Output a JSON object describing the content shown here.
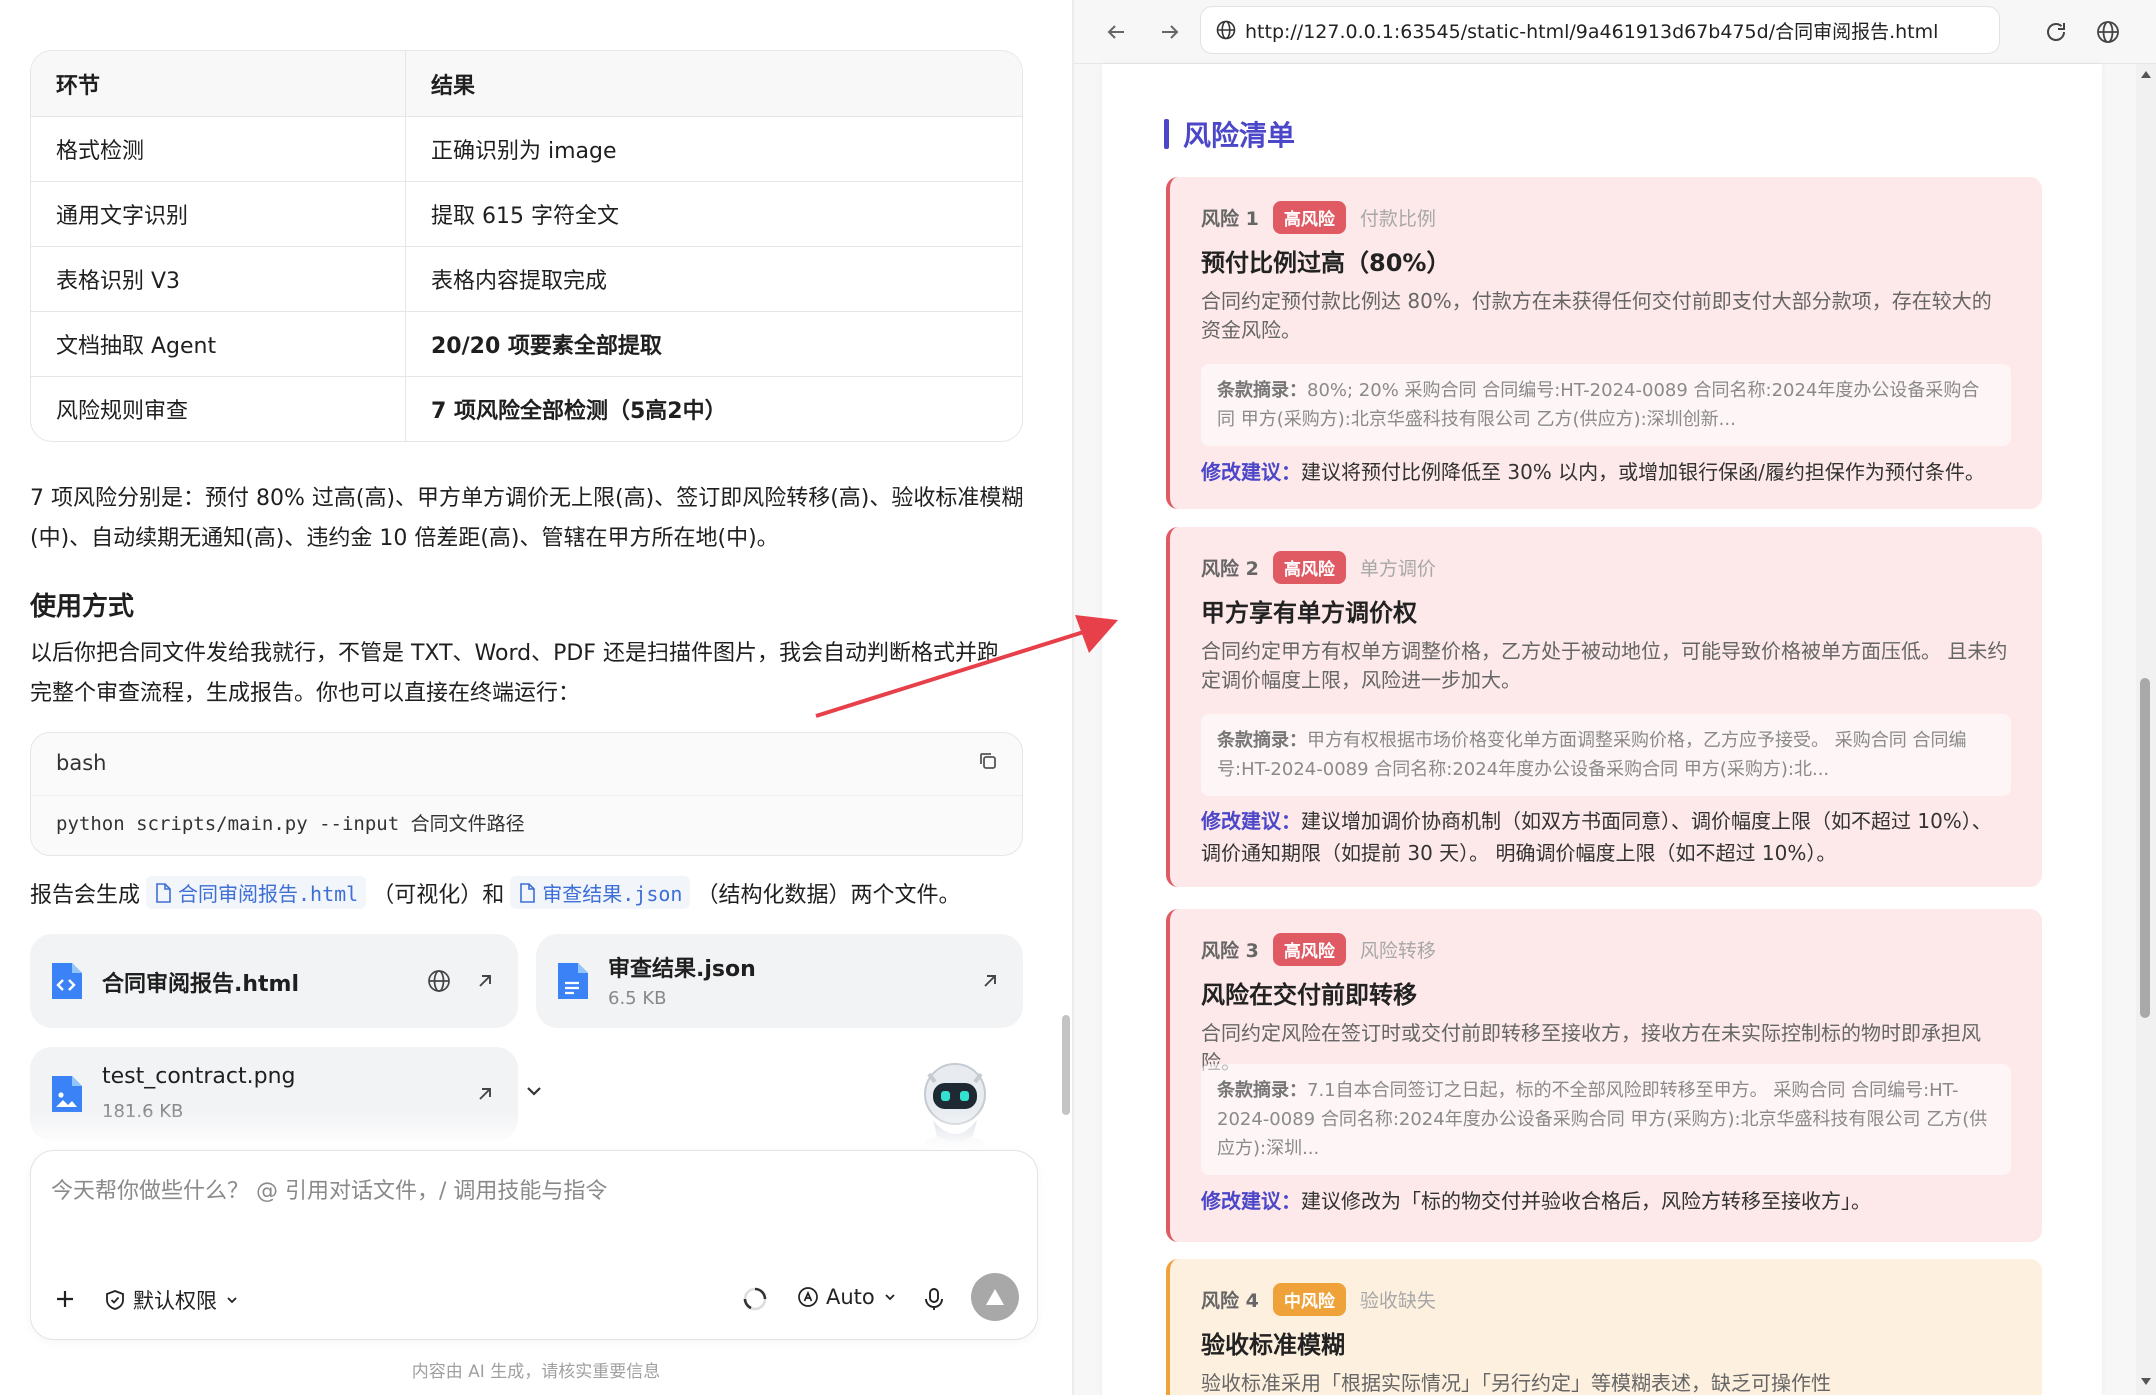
{
  "chat": {
    "table": {
      "headers": [
        "环节",
        "结果"
      ],
      "rows": [
        {
          "step": "格式检测",
          "result": "正确识别为 image",
          "bold": false
        },
        {
          "step": "通用文字识别",
          "result": "提取 615 字符全文",
          "bold": false
        },
        {
          "step": "表格识别 V3",
          "result": "表格内容提取完成",
          "bold": false
        },
        {
          "step": "文档抽取 Agent",
          "result": "20/20 项要素全部提取",
          "bold": true
        },
        {
          "step": "风险规则审查",
          "result": "7 项风险全部检测（5高2中）",
          "bold": true
        }
      ]
    },
    "summary_line1": "7 项风险分别是：预付 80% 过高(高)、甲方单方调价无上限(高)、签订即风险转移(高)、验收标准模糊",
    "summary_line2": "(中)、自动续期无通知(高)、违约金 10 倍差距(高)、管辖在甲方所在地(中)。",
    "usage_heading": "使用方式",
    "usage_line1": "以后你把合同文件发给我就行，不管是 TXT、Word、PDF 还是扫描件图片，我会自动判断格式并跑",
    "usage_line2": "完整个审查流程，生成报告。你也可以直接在终端运行：",
    "code": {
      "lang": "bash",
      "command": "python scripts/main.py --input 合同文件路径"
    },
    "report_text_before": "报告会生成",
    "report_file1": "合同审阅报告.html",
    "report_text_mid": "（可视化）和",
    "report_file2": "审查结果.json",
    "report_text_after": "（结构化数据）两个文件。",
    "files": [
      {
        "name": "合同审阅报告.html",
        "size": "",
        "icon": "code-file-icon"
      },
      {
        "name": "审查结果.json",
        "size": "6.5 KB",
        "icon": "doc-file-icon"
      },
      {
        "name": "test_contract.png",
        "size": "181.6 KB",
        "icon": "image-file-icon"
      }
    ],
    "input_placeholder": "今天帮你做些什么？ @ 引用对话文件，/ 调用技能与指令",
    "permission_label": "默认权限",
    "model_label": "Auto",
    "footnote": "内容由 AI 生成，请核实重要信息"
  },
  "browser": {
    "url": "http://127.0.0.1:63545/static-html/9a461913d67b475d/合同审阅报告.html",
    "section_title": "风险清单",
    "risks": [
      {
        "num": "风险 1",
        "level": "高风险",
        "category": "付款比例",
        "title": "预付比例过高（80%）",
        "desc": "合同约定预付款比例达 80%，付款方在未获得任何交付前即支付大部分款项，存在较大的资金风险。",
        "clause_label": "条款摘录：",
        "clause": "80%; 20% 采购合同 合同编号:HT-2024-0089 合同名称:2024年度办公设备采购合同 甲方(采购方):北京华盛科技有限公司 乙方(供应方):深圳创新...",
        "sugg_label": "修改建议：",
        "sugg": "建议将预付比例降低至 30% 以内，或增加银行保函/履约担保作为预付条件。"
      },
      {
        "num": "风险 2",
        "level": "高风险",
        "category": "单方调价",
        "title": "甲方享有单方调价权",
        "desc": "合同约定甲方有权单方调整价格，乙方处于被动地位，可能导致价格被单方面压低。 且未约定调价幅度上限，风险进一步加大。",
        "clause_label": "条款摘录：",
        "clause": "甲方有权根据市场价格变化单方面调整采购价格，乙方应予接受。 采购合同 合同编号:HT-2024-0089 合同名称:2024年度办公设备采购合同 甲方(采购方):北...",
        "sugg_label": "修改建议：",
        "sugg": "建议增加调价协商机制（如双方书面同意）、调价幅度上限（如不超过 10%）、调价通知期限（如提前 30 天）。 明确调价幅度上限（如不超过 10%）。"
      },
      {
        "num": "风险 3",
        "level": "高风险",
        "category": "风险转移",
        "title": "风险在交付前即转移",
        "desc": "合同约定风险在签订时或交付前即转移至接收方，接收方在未实际控制标的物时即承担风险。",
        "clause_label": "条款摘录：",
        "clause": "7.1自本合同签订之日起，标的不全部风险即转移至甲方。 采购合同 合同编号:HT-2024-0089 合同名称:2024年度办公设备采购合同 甲方(采购方):北京华盛科技有限公司 乙方(供应方):深圳...",
        "sugg_label": "修改建议：",
        "sugg": "建议修改为「标的物交付并验收合格后，风险方转移至接收方」。"
      },
      {
        "num": "风险 4",
        "level": "中风险",
        "category": "验收缺失",
        "title": "验收标准模糊",
        "desc": "验收标准采用「根据实际情况」「另行约定」等模糊表述，缺乏可操作性"
      }
    ]
  }
}
